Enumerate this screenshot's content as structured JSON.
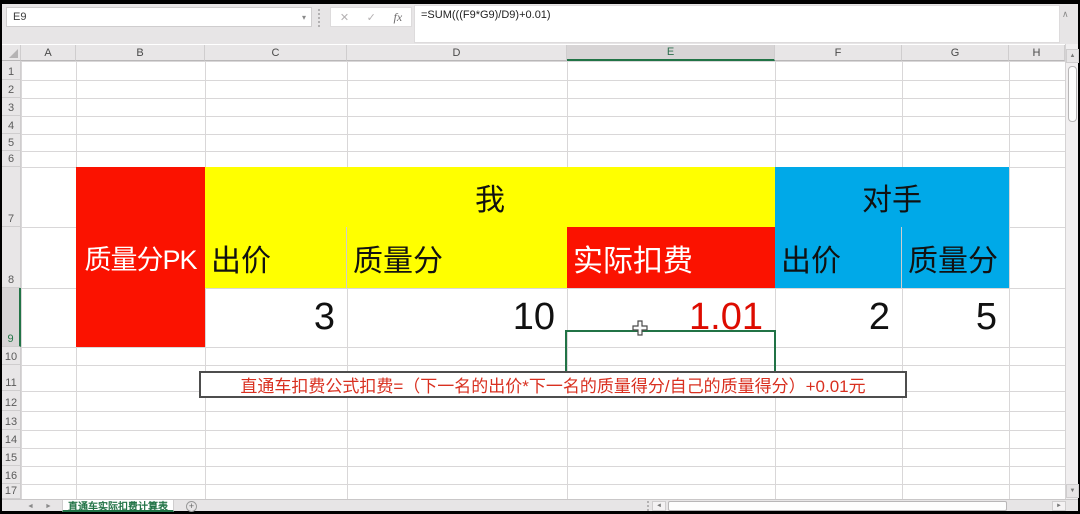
{
  "formula_bar": {
    "cell_reference": "E9",
    "formula": "=SUM(((F9*G9)/D9)+0.01)"
  },
  "icons": {
    "name_box_dropdown": "▾",
    "cancel": "✕",
    "enter": "✓",
    "function": "fx",
    "collapse_formula_bar": "∧",
    "scroll_up": "▲",
    "scroll_down": "▼",
    "scroll_left": "◄",
    "scroll_right": "►",
    "tab_nav_left": "◄",
    "tab_nav_right": "►",
    "add_sheet": "+"
  },
  "grid": {
    "column_headers": [
      "A",
      "B",
      "C",
      "D",
      "E",
      "F",
      "G",
      "H"
    ],
    "row_headers": [
      "1",
      "2",
      "3",
      "4",
      "5",
      "6",
      "7",
      "8",
      "9",
      "10",
      "11",
      "12",
      "13",
      "14",
      "15",
      "16",
      "17"
    ],
    "selected_column": "E",
    "selected_row": "9",
    "selected_cell": "E9"
  },
  "table": {
    "pk_label": "质量分PK",
    "me_label": "我",
    "opponent_label": "对手",
    "headers": {
      "me_bid": "出价",
      "me_quality": "质量分",
      "me_fee": "实际扣费",
      "opp_bid": "出价",
      "opp_quality": "质量分"
    },
    "values": {
      "me_bid": "3",
      "me_quality": "10",
      "me_fee": "1.01",
      "opp_bid": "2",
      "opp_quality": "5"
    }
  },
  "note_box": {
    "text": "直通车扣费公式扣费=（下一名的出价*下一名的质量得分/自己的质量得分）+0.01元"
  },
  "sheet_bar": {
    "active_tab": "直通车实际扣费计算表"
  },
  "colors": {
    "cell_red": "#fb1200",
    "cell_yellow": "#ffff00",
    "cell_blue": "#00a9e8",
    "accent_green": "#217346",
    "value_red": "#dd0b00",
    "note_red": "#d93020"
  }
}
